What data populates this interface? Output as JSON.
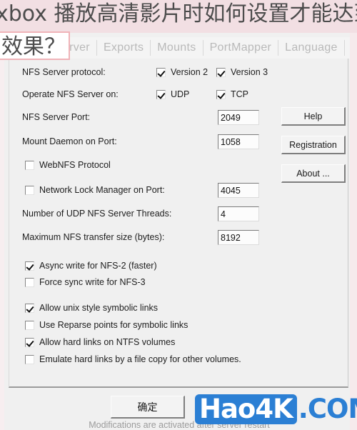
{
  "overlay": {
    "line1": "xbox 播放高清影片时如何设置才能达到最佳",
    "line2": "效果？",
    "band_color": "#f2dfe3",
    "highlight_border": "#f0b3b8"
  },
  "tabs": [
    {
      "label": "Server",
      "selected": false
    },
    {
      "label": "Exports",
      "selected": false
    },
    {
      "label": "Mounts",
      "selected": false
    },
    {
      "label": "PortMapper",
      "selected": false
    },
    {
      "label": "Language",
      "selected": false
    }
  ],
  "settings": {
    "protocol_label": "NFS Server protocol:",
    "protocol_v2": {
      "label": "Version 2",
      "checked": true
    },
    "protocol_v3": {
      "label": "Version 3",
      "checked": true
    },
    "operate_label": "Operate NFS Server on:",
    "operate_udp": {
      "label": "UDP",
      "checked": true
    },
    "operate_tcp": {
      "label": "TCP",
      "checked": true
    },
    "nfs_port_label": "NFS Server Port:",
    "nfs_port_value": "2049",
    "mount_daemon_label": "Mount Daemon on Port:",
    "mount_daemon_value": "1058",
    "webnfs": {
      "label": "WebNFS Protocol",
      "checked": false
    },
    "nlm": {
      "label": "Network Lock Manager on Port:",
      "checked": false,
      "value": "4045"
    },
    "udp_threads_label": "Number of UDP NFS Server Threads:",
    "udp_threads_value": "4",
    "max_transfer_label": "Maximum NFS transfer size (bytes):",
    "max_transfer_value": "8192",
    "async_write": {
      "label": "Async write for NFS-2 (faster)",
      "checked": true
    },
    "force_sync": {
      "label": "Force sync write for NFS-3",
      "checked": false
    },
    "unix_symlinks": {
      "label": "Allow unix style symbolic links",
      "checked": true
    },
    "reparse_points": {
      "label": "Use Reparse points for symbolic links",
      "checked": false
    },
    "hard_links_ntfs": {
      "label": "Allow hard links on NTFS volumes",
      "checked": true
    },
    "emulate_hard_links": {
      "label": "Emulate hard links by a file copy for other volumes.",
      "checked": false
    }
  },
  "side_buttons": {
    "help": "Help",
    "registration": "Registration",
    "about": "About ..."
  },
  "status_note": "Modifications are activated after server restart",
  "ok_button": "确定",
  "watermark": {
    "name": "Hao4K",
    "suffix": ".COM",
    "color": "#2b7fd4"
  }
}
